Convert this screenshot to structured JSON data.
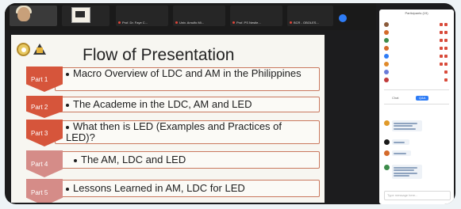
{
  "slide": {
    "title": "Flow of Presentation",
    "items": [
      {
        "part": "Part 1",
        "text": "Macro Overview of LDC and AM in the Philippines",
        "color": "#d6553b"
      },
      {
        "part": "Part 2",
        "text": "The Academe in the LDC, AM and LED",
        "color": "#d6553b"
      },
      {
        "part": "Part 3",
        "text": "What then is LED (Examples and Practices of LED)?",
        "color": "#d6553b"
      },
      {
        "part": "Part 4",
        "text": "The AM, LDC and LED",
        "color": "#d58c88"
      },
      {
        "part": "Part 5",
        "text": "Lessons Learned in AM, LDC for LED",
        "color": "#d58c88"
      }
    ]
  },
  "participant_strip": {
    "tiles": [
      {
        "name": "Prof. Dr. Faye C..."
      },
      {
        "name": "Univ. Arnulfo Mi..."
      },
      {
        "name": "Prof. PS Nestle..."
      },
      {
        "name": "BCR - OBOLES..."
      }
    ]
  },
  "panel": {
    "title": "Participants (19)",
    "tabs": [
      "Chat",
      "Q&A"
    ],
    "input_placeholder": "Type message here...",
    "colors": {
      "accent": "#2e7cf6",
      "muted_icon": "#d84a3a"
    }
  }
}
